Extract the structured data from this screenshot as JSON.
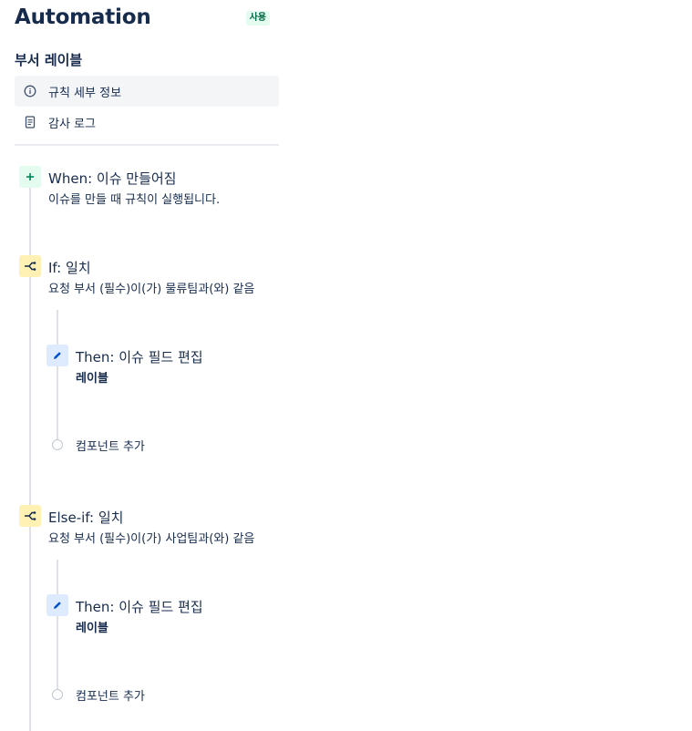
{
  "header": {
    "title": "Automation",
    "status": "사용"
  },
  "rule": {
    "name": "부서 레이블"
  },
  "nav": {
    "items": [
      {
        "label": "규칙 세부 정보",
        "icon": "info-icon",
        "active": true
      },
      {
        "label": "감사 로그",
        "icon": "document-icon",
        "active": false
      }
    ]
  },
  "flow": {
    "trigger": {
      "title": "When: 이슈 만들어짐",
      "desc": "이슈를 만들 때 규칙이 실행됩니다.",
      "icon": "plus-icon"
    },
    "if": {
      "title": "If: 일치",
      "desc": "요청 부서 (필수)이(가) 물류팀과(와) 같음",
      "icon": "branch-icon",
      "then": {
        "title": "Then: 이슈 필드 편집",
        "desc": "레이블",
        "icon": "pencil-icon"
      },
      "add_component": "컴포넌트 추가"
    },
    "elseif": {
      "title": "Else-if: 일치",
      "desc": "요청 부서 (필수)이(가) 사업팀과(와) 같음",
      "icon": "branch-icon",
      "then": {
        "title": "Then: 이슈 필드 편집",
        "desc": "레이블",
        "icon": "pencil-icon"
      },
      "add_component": "컴포넌트 추가"
    }
  },
  "colors": {
    "text": "#172B4D",
    "trigger_bg": "#E3FCEF",
    "trigger_fg": "#00875A",
    "condition_bg": "#FFF0B3",
    "condition_fg": "#172B4D",
    "action_bg": "#DEEBFF",
    "action_fg": "#0052CC",
    "line": "#DFE1E6"
  }
}
